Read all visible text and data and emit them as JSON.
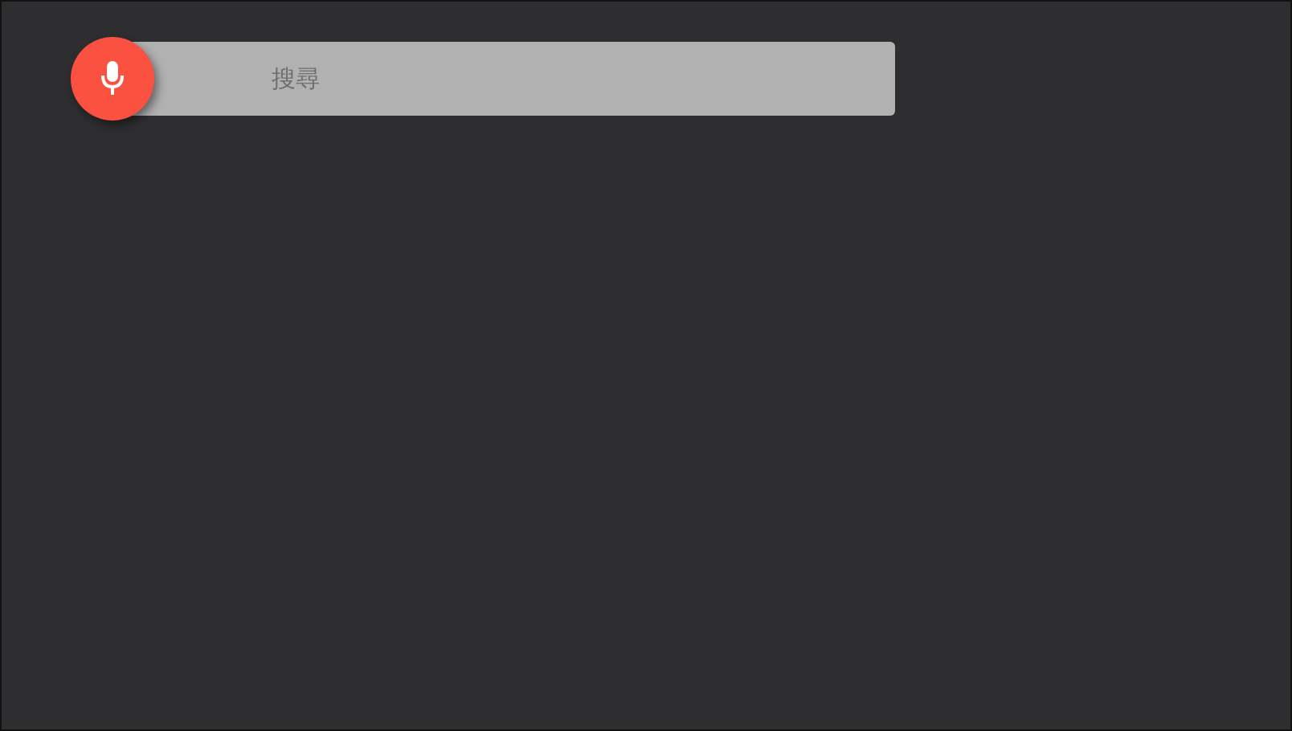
{
  "search": {
    "placeholder": "搜尋"
  }
}
